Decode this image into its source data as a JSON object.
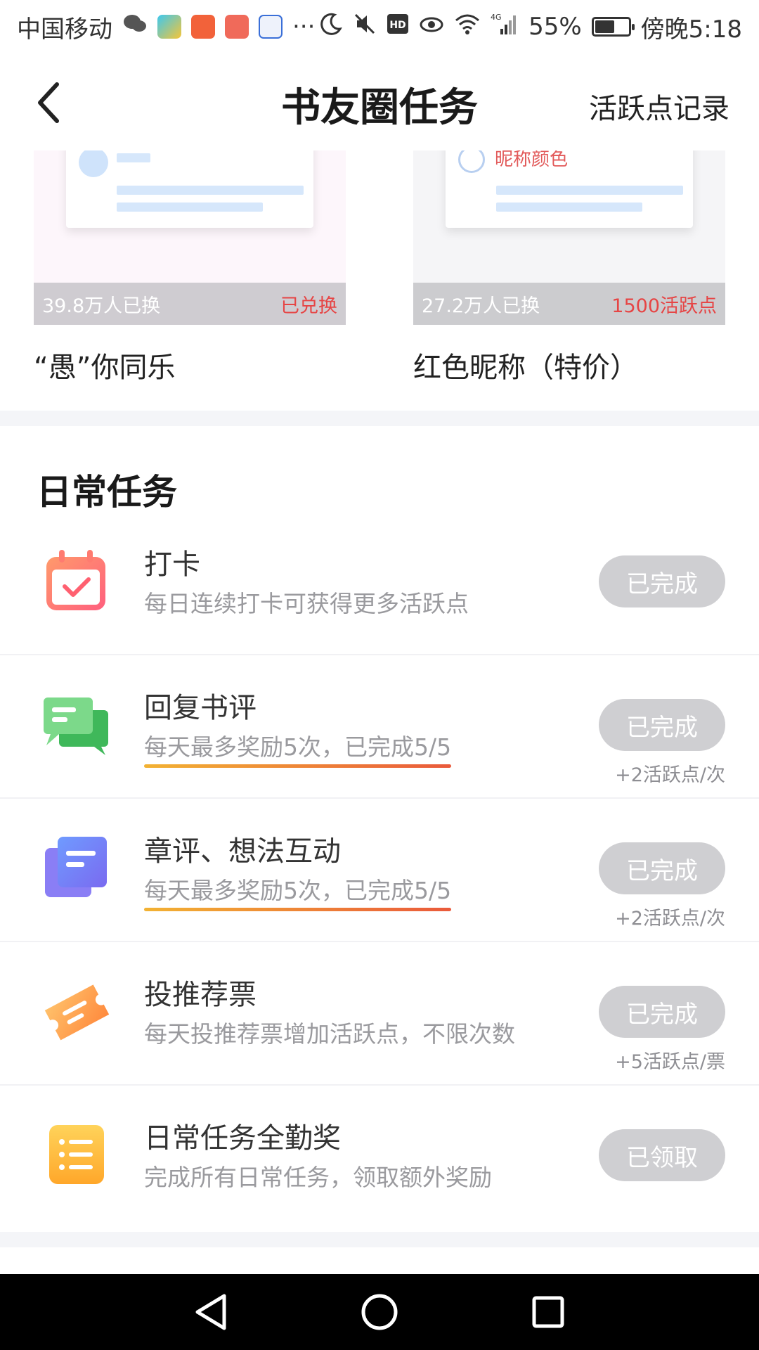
{
  "status_bar": {
    "carrier": "中国移动",
    "more": "···",
    "network": "4G",
    "battery": "55%",
    "time": "傍晚5:18"
  },
  "header": {
    "title": "书友圈任务",
    "record_link": "活跃点记录"
  },
  "rewards": [
    {
      "count": "39.8万人已换",
      "status": "已兑换",
      "name": "“愚”你同乐"
    },
    {
      "count": "27.2万人已换",
      "status": "1500活跃点",
      "name": "红色昵称（特价）",
      "preview_label": "昵称颜色"
    }
  ],
  "daily": {
    "title": "日常任务",
    "tasks": [
      {
        "title": "打卡",
        "desc": "每日连续打卡可获得更多活跃点",
        "button": "已完成",
        "reward": ""
      },
      {
        "title": "回复书评",
        "desc": "每天最多奖励5次，已完成5/5",
        "button": "已完成",
        "reward": "+2活跃点/次"
      },
      {
        "title": "章评、想法互动",
        "desc": "每天最多奖励5次，已完成5/5",
        "button": "已完成",
        "reward": "+2活跃点/次"
      },
      {
        "title": "投推荐票",
        "desc": "每天投推荐票增加活跃点，不限次数",
        "button": "已完成",
        "reward": "+5活跃点/票"
      },
      {
        "title": "日常任务全勤奖",
        "desc": "完成所有日常任务，领取额外奖励",
        "button": "已领取",
        "reward": ""
      }
    ]
  },
  "colors": {
    "accent_red": "#e64545",
    "button_done": "#cfcfd2",
    "progress_start": "#f2b233",
    "progress_end": "#ea5a3b"
  }
}
